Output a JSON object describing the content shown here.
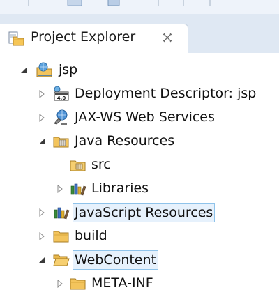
{
  "view": {
    "title": "Project Explorer"
  },
  "tree": [
    {
      "label": "jsp",
      "expanded": true,
      "icon": "web-project-icon"
    },
    {
      "label": "Deployment Descriptor: jsp",
      "expanded": false,
      "icon": "deployment-descriptor-icon"
    },
    {
      "label": "JAX-WS Web Services",
      "expanded": false,
      "icon": "web-services-icon"
    },
    {
      "label": "Java Resources",
      "expanded": true,
      "icon": "java-resources-icon"
    },
    {
      "label": "src",
      "icon": "source-folder-icon"
    },
    {
      "label": "Libraries",
      "expanded": false,
      "icon": "libraries-icon"
    },
    {
      "label": "JavaScript Resources",
      "expanded": false,
      "icon": "javascript-resources-icon"
    },
    {
      "label": "build",
      "expanded": false,
      "icon": "folder-icon"
    },
    {
      "label": "WebContent",
      "expanded": true,
      "icon": "folder-open-icon"
    },
    {
      "label": "META-INF",
      "expanded": false,
      "icon": "folder-icon"
    }
  ],
  "colors": {
    "selection_fill": "#e6f1fc",
    "selection_border": "#8fc3ea",
    "tab_bar": "#dfe8f3"
  }
}
